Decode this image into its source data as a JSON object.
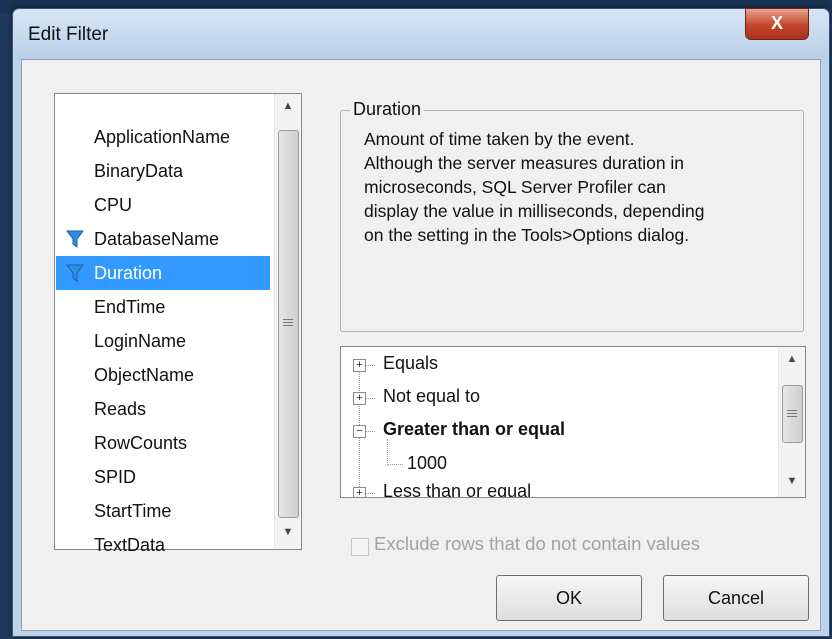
{
  "dialog": {
    "title": "Edit Filter",
    "close_glyph": "X"
  },
  "fields": {
    "items": [
      {
        "label": "ApplicationName",
        "filtered": false,
        "selected": false
      },
      {
        "label": "BinaryData",
        "filtered": false,
        "selected": false
      },
      {
        "label": "CPU",
        "filtered": false,
        "selected": false
      },
      {
        "label": "DatabaseName",
        "filtered": true,
        "selected": false
      },
      {
        "label": "Duration",
        "filtered": true,
        "selected": true
      },
      {
        "label": "EndTime",
        "filtered": false,
        "selected": false
      },
      {
        "label": "LoginName",
        "filtered": false,
        "selected": false
      },
      {
        "label": "ObjectName",
        "filtered": false,
        "selected": false
      },
      {
        "label": "Reads",
        "filtered": false,
        "selected": false
      },
      {
        "label": "RowCounts",
        "filtered": false,
        "selected": false
      },
      {
        "label": "SPID",
        "filtered": false,
        "selected": false
      },
      {
        "label": "StartTime",
        "filtered": false,
        "selected": false
      },
      {
        "label": "TextData",
        "filtered": false,
        "selected": false
      }
    ],
    "filter_icon": "funnel-icon"
  },
  "description": {
    "title": "Duration",
    "lines": [
      "Amount of time taken by the event.",
      "Although the server measures duration in",
      "microseconds, SQL Server Profiler can",
      "display the value in milliseconds, depending",
      "on the setting in the Tools>Options dialog."
    ]
  },
  "tree": {
    "nodes": [
      {
        "label": "Equals",
        "expander": "+",
        "bold": false
      },
      {
        "label": "Not equal to",
        "expander": "+",
        "bold": false
      },
      {
        "label": "Greater than or equal",
        "expander": "−",
        "bold": true
      },
      {
        "label": "Less than or equal",
        "expander": "+",
        "bold": false
      }
    ],
    "child_value": "1000"
  },
  "exclude_option": {
    "label": "Exclude rows that do not contain values",
    "checked": false,
    "enabled": false
  },
  "buttons": {
    "ok": "OK",
    "cancel": "Cancel"
  },
  "colors": {
    "selection": "#3399ff",
    "funnel": "#2e8fe0"
  }
}
